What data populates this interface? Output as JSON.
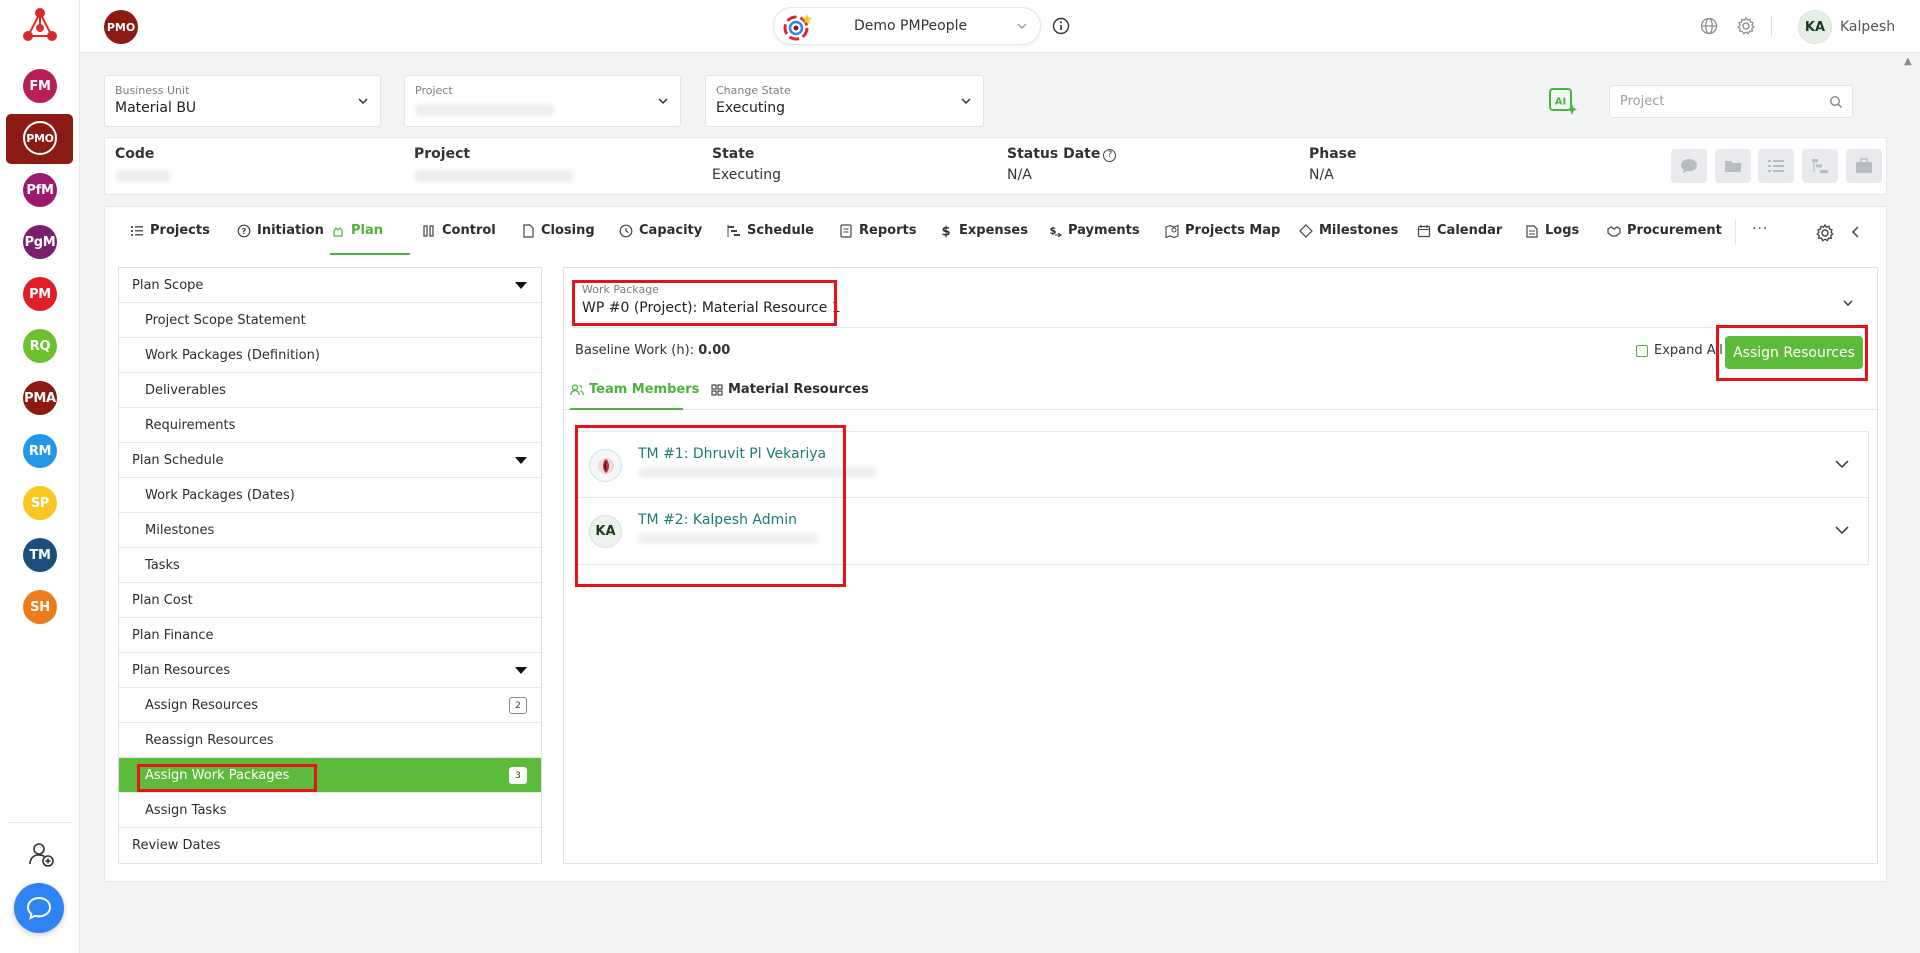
{
  "rail": {
    "items": [
      {
        "label": "FM",
        "color": "#b81e58"
      },
      {
        "label": "PMO",
        "color": "#8b1a12"
      },
      {
        "label": "PfM",
        "color": "#9b1a6d"
      },
      {
        "label": "PgM",
        "color": "#7a1f6d"
      },
      {
        "label": "PM",
        "color": "#e11d26"
      },
      {
        "label": "RQ",
        "color": "#6cc12f"
      },
      {
        "label": "PMA",
        "color": "#8b1a12"
      },
      {
        "label": "RM",
        "color": "#2496e8"
      },
      {
        "label": "SP",
        "color": "#f7c722"
      },
      {
        "label": "TM",
        "color": "#1b4f7c"
      },
      {
        "label": "SH",
        "color": "#ef7c1c"
      }
    ]
  },
  "topbar": {
    "app_badge": "PMO",
    "workspace_name": "Demo PMPeople",
    "user_initials": "KA",
    "user_name": "Kalpesh"
  },
  "filters": {
    "business_unit_label": "Business Unit",
    "business_unit_value": "Material BU",
    "project_label": "Project",
    "change_state_label": "Change State",
    "change_state_value": "Executing",
    "search_placeholder": "Project",
    "ai_label": "AI"
  },
  "info": {
    "code_head": "Code",
    "project_head": "Project",
    "state_head": "State",
    "state_value": "Executing",
    "status_date_head": "Status Date",
    "status_date_value": "N/A",
    "phase_head": "Phase",
    "phase_value": "N/A"
  },
  "tabs": [
    {
      "label": "Projects",
      "icon": "list-icon"
    },
    {
      "label": "Initiation",
      "icon": "question-circle-icon"
    },
    {
      "label": "Plan",
      "icon": "hand-icon",
      "active": true
    },
    {
      "label": "Control",
      "icon": "columns-icon"
    },
    {
      "label": "Closing",
      "icon": "file-icon"
    },
    {
      "label": "Capacity",
      "icon": "clock-icon"
    },
    {
      "label": "Schedule",
      "icon": "gantt-icon"
    },
    {
      "label": "Reports",
      "icon": "report-icon"
    },
    {
      "label": "Expenses",
      "icon": "dollar-icon"
    },
    {
      "label": "Payments",
      "icon": "payment-icon"
    },
    {
      "label": "Projects Map",
      "icon": "map-icon"
    },
    {
      "label": "Milestones",
      "icon": "diamond-icon"
    },
    {
      "label": "Calendar",
      "icon": "calendar-icon"
    },
    {
      "label": "Logs",
      "icon": "logs-icon"
    },
    {
      "label": "Procurement",
      "icon": "handshake-icon"
    }
  ],
  "tabs_more": "···",
  "side_menu": [
    {
      "label": "Plan Scope",
      "level": 0,
      "expandable": true
    },
    {
      "label": "Project Scope Statement",
      "level": 1
    },
    {
      "label": "Work Packages (Definition)",
      "level": 1
    },
    {
      "label": "Deliverables",
      "level": 1
    },
    {
      "label": "Requirements",
      "level": 1
    },
    {
      "label": "Plan Schedule",
      "level": 0,
      "expandable": true
    },
    {
      "label": "Work Packages (Dates)",
      "level": 1
    },
    {
      "label": "Milestones",
      "level": 1
    },
    {
      "label": "Tasks",
      "level": 1
    },
    {
      "label": "Plan Cost",
      "level": 0
    },
    {
      "label": "Plan Finance",
      "level": 0
    },
    {
      "label": "Plan Resources",
      "level": 0,
      "expandable": true
    },
    {
      "label": "Assign Resources",
      "level": 1,
      "count": "2"
    },
    {
      "label": "Reassign Resources",
      "level": 1
    },
    {
      "label": "Assign Work Packages",
      "level": 1,
      "count": "3",
      "active": true
    },
    {
      "label": "Assign Tasks",
      "level": 1
    },
    {
      "label": "Review Dates",
      "level": 0
    }
  ],
  "panel": {
    "wp_label": "Work Package",
    "wp_value": "WP #0 (Project): Material Resource 1",
    "baseline_label": "Baseline Work (h):",
    "baseline_value": "0.00",
    "expand_all": "Expand All",
    "assign_button": "Assign Resources",
    "subtab_team": "Team Members",
    "subtab_material": "Material Resources",
    "members": [
      {
        "name": "TM #1: Dhruvit Pl Vekariya",
        "initials": ""
      },
      {
        "name": "TM #2: Kalpesh Admin",
        "initials": "KA"
      }
    ]
  },
  "colors": {
    "accent_green": "#5dbb3b",
    "brand_red": "#8b1a12",
    "annotation_red": "#e5141b",
    "member_link": "#1e7a74"
  }
}
